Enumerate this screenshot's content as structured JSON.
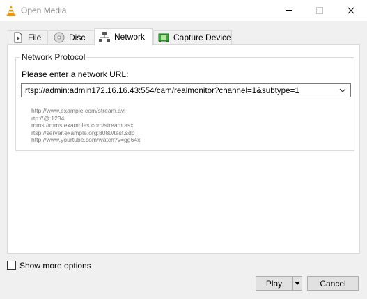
{
  "window": {
    "title": "Open Media"
  },
  "tabs": [
    {
      "label": "File",
      "icon": "file-icon"
    },
    {
      "label": "Disc",
      "icon": "disc-icon"
    },
    {
      "label": "Network",
      "icon": "network-icon",
      "active": true
    },
    {
      "label": "Capture Device",
      "icon": "capture-device-icon"
    }
  ],
  "network": {
    "group_title": "Network Protocol",
    "url_label": "Please enter a network URL:",
    "url_value": "rtsp://admin:admin172.16.16.43:554/cam/realmonitor?channel=1&subtype=1",
    "examples": [
      "http://www.example.com/stream.avi",
      "rtp://@:1234",
      "mms://mms.examples.com/stream.asx",
      "rtsp://server.example.org:8080/test.sdp",
      "http://www.yourtube.com/watch?v=gg64x"
    ]
  },
  "options": {
    "show_more_label": "Show more options",
    "checked": false
  },
  "buttons": {
    "play": "Play",
    "cancel": "Cancel"
  },
  "colors": {
    "vlc_orange": "#f39200",
    "capture_green": "#3aa63a"
  }
}
